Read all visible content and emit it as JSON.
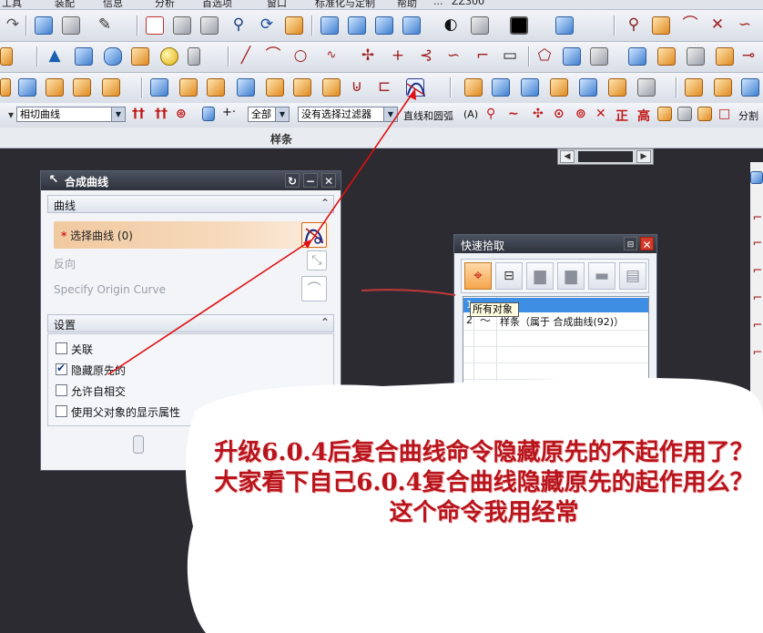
{
  "menubar": {
    "items": [
      "工具",
      "装配",
      "信息",
      "分析",
      "首选项",
      "窗口",
      "标准化与定制",
      "帮助",
      "...",
      "ZZ300"
    ]
  },
  "filterbar": {
    "curve_rule": "相切曲线",
    "scope": "全部",
    "selection_filter": "没有选择过滤器",
    "snap_label": "直线和圆弧",
    "snap_suffix": "(A)",
    "right_label": "分割"
  },
  "palette_label": "样条",
  "composite_dialog": {
    "title": "合成曲线",
    "section_curve": "曲线",
    "select_curve_required": "*",
    "select_curve": "选择曲线 (0)",
    "reverse": "反向",
    "specify_origin": "Specify Origin Curve",
    "section_settings": "设置",
    "options": [
      {
        "label": "关联",
        "checked": false
      },
      {
        "label": "隐藏原先的",
        "checked": true
      },
      {
        "label": "允许自相交",
        "checked": false
      },
      {
        "label": "使用父对象的显示属性",
        "checked": false
      }
    ]
  },
  "quickpick_dialog": {
    "title": "快速拾取",
    "rows": [
      {
        "num": "1",
        "text": ""
      },
      {
        "num": "2",
        "text": "样条（属于 合成曲线(92)）"
      }
    ],
    "tooltip": "所有对象"
  },
  "annotation": {
    "text": "升级6.0.4后复合曲线命令隐藏原先的不起作用了？大家看下自己6.0.4复合曲线隐藏原先的起作用么？这个命令我用经常"
  },
  "colors": {
    "accent": "#e8a060",
    "annotation_red": "#b8141c",
    "arrow_red": "#e01010",
    "background": "#2b2b31"
  }
}
